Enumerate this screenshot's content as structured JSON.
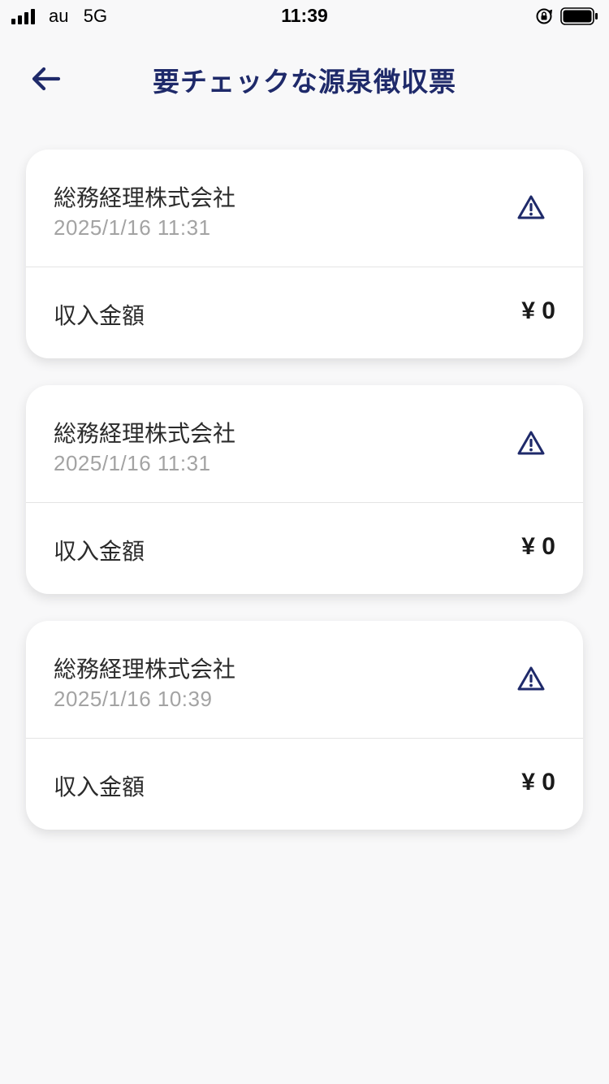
{
  "status_bar": {
    "carrier": "au   5G",
    "time": "11:39",
    "lock_icon": "orientation-lock-icon",
    "battery_icon": "battery-icon",
    "signal_icon": "signal-bars-icon"
  },
  "header": {
    "back_icon": "arrow-left-icon",
    "title": "要チェックな源泉徴収票"
  },
  "cards": [
    {
      "company": "総務経理株式会社",
      "timestamp": "2025/1/16 11:31",
      "amount_label": "収入金額",
      "amount": "¥ 0",
      "icon": "warning-triangle-icon"
    },
    {
      "company": "総務経理株式会社",
      "timestamp": "2025/1/16 11:31",
      "amount_label": "収入金額",
      "amount": "¥ 0",
      "icon": "warning-triangle-icon"
    },
    {
      "company": "総務経理株式会社",
      "timestamp": "2025/1/16 10:39",
      "amount_label": "収入金額",
      "amount": "¥ 0",
      "icon": "warning-triangle-icon"
    }
  ],
  "colors": {
    "accent": "#1f2a6a",
    "background": "#f8f8f9",
    "card": "#ffffff",
    "muted_text": "#a3a3a3"
  }
}
